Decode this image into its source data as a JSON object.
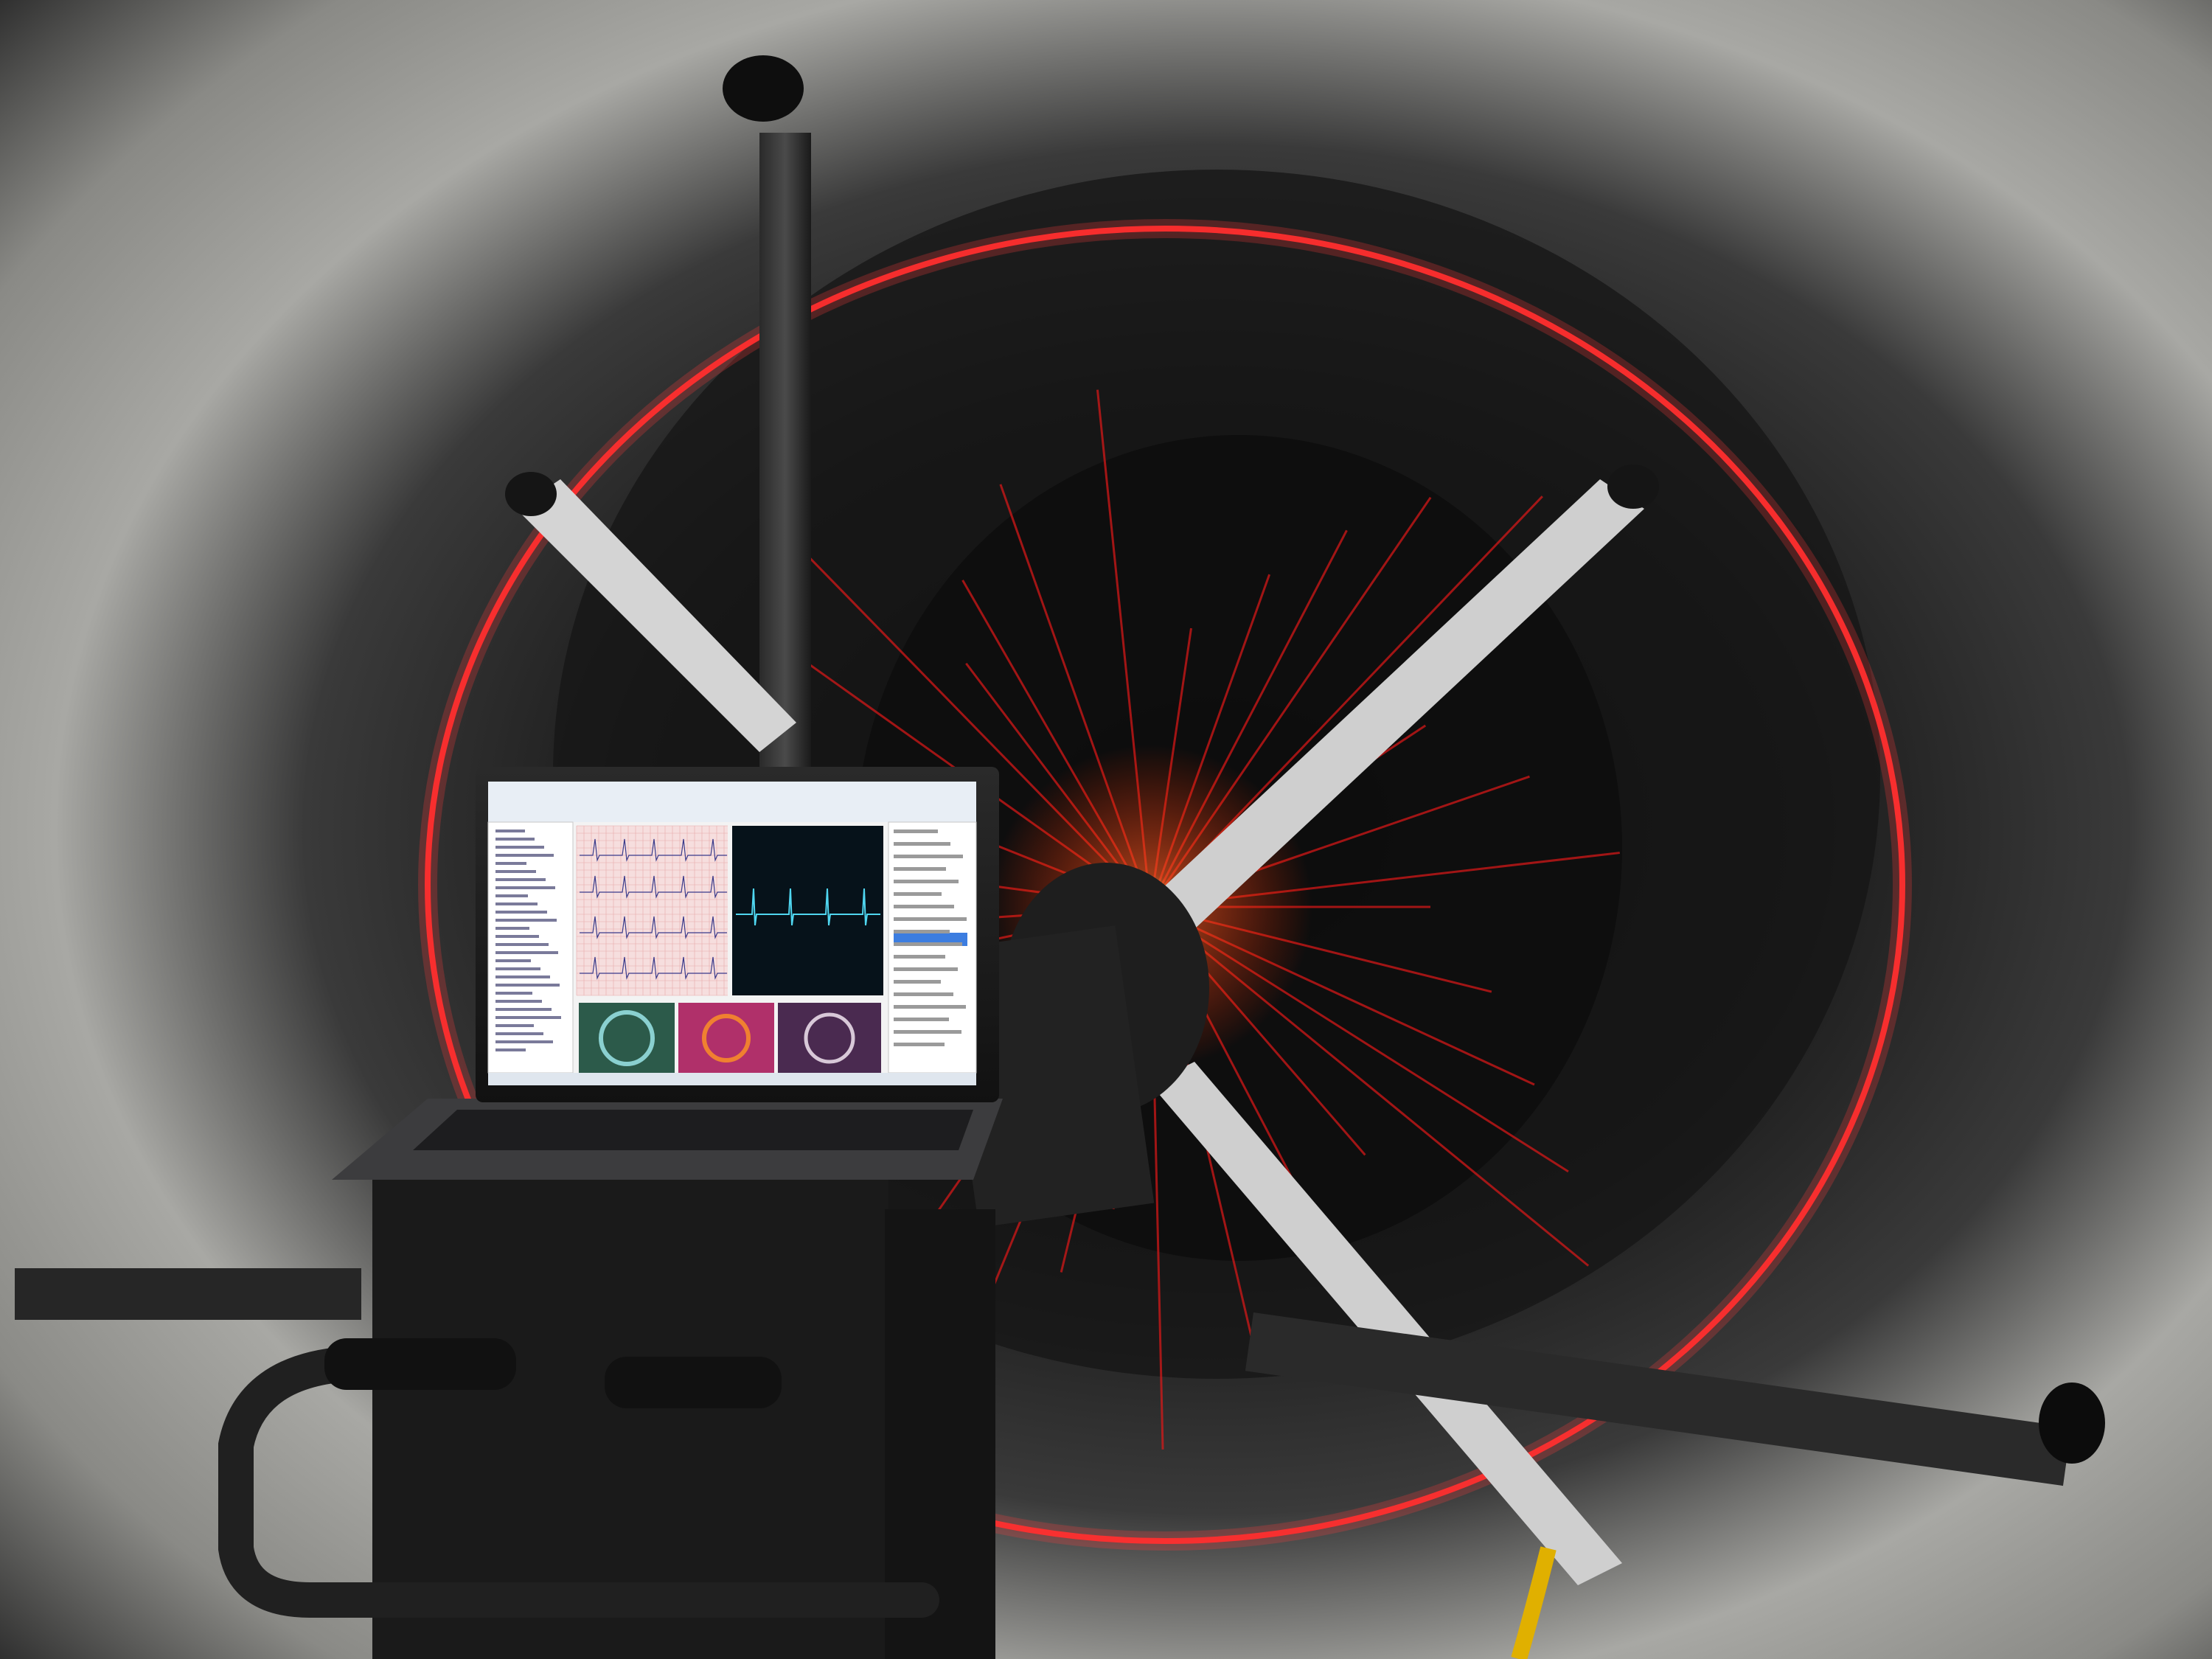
{
  "scene": {
    "description_colors": {
      "tunnel_wall": "#9a9a96",
      "tunnel_dark": "#101010",
      "laser_ring": "#ff2a2a",
      "laser_rays": "#e01818",
      "carbon_frame": "#1c1c1c",
      "aluminum_arm": "#c8c8c8"
    }
  },
  "laptop": {
    "ecg_panel_label": "ECG",
    "monitor_bg": "#06121a",
    "monitor_trace": "#4fd6f0",
    "grid_pink": "#f6dede",
    "grid_lines": "#e7a9a9",
    "trace_dark": "#3a3a8a"
  }
}
